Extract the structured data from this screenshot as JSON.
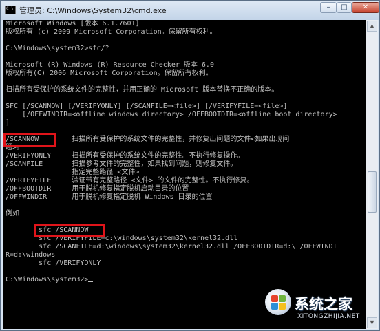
{
  "window": {
    "title": "管理员: C:\\Windows\\System32\\cmd.exe",
    "icon": "cmd-icon",
    "buttons": {
      "minimize": "–",
      "maximize": "□",
      "close": "✕"
    }
  },
  "console": {
    "lines": [
      "Microsoft Windows [版本 6.1.7601]",
      "版权所有 (c) 2009 Microsoft Corporation。保留所有权利。",
      "",
      "C:\\Windows\\system32>sfc/?",
      "",
      "Microsoft (R) Windows (R) Resource Checker 版本 6.0",
      "版权所有(C) 2006 Microsoft Corporation。保留所有权利。",
      "",
      "扫描所有受保护的系统文件的完整性，并用正确的 Microsoft 版本替换不正确的版本。",
      "",
      "SFC [/SCANNOW] [/VERIFYONLY] [/SCANFILE=<file>] [/VERIFYFILE=<file>]",
      "    [/OFFWINDIR=<offline windows directory> /OFFBOOTDIR=<offline boot directory>",
      "]",
      "",
      "/SCANNOW        扫描所有受保护的系统文件的完整性，并修复出问题的文件<如果出现问",
      "题>。",
      "/VERIFYONLY     扫描所有受保护的系统文件的完整性。不执行修复操作。",
      "/SCANFILE       扫描参考文件的完整性，如果找到问题，则修复文件。",
      "                指定完整路径 <文件>",
      "/VERIFYFILE     验证带有完整路径 <文件> 的文件的完整性。不执行修复。",
      "/OFFBOOTDIR     用于脱机修复指定脱机启动目录的位置",
      "/OFFWINDIR      用于脱机修复指定脱机 Windows 目录的位置",
      "",
      "例如",
      "",
      "        sfc /SCANNOW",
      "        sfc /VERIFYFILE=c:\\windows\\system32\\kernel32.dll",
      "        sfc /SCANFILE=d:\\windows\\system32\\kernel32.dll /OFFBOOTDIR=d:\\ /OFFWINDI",
      "R=d:\\windows",
      "        sfc /VERIFYONLY",
      "",
      "C:\\Windows\\system32>"
    ]
  },
  "highlights": [
    {
      "label": "scannow-option"
    },
    {
      "label": "scannow-example"
    }
  ],
  "watermark": {
    "text": "系统之家",
    "url": "XITONGZHIJIA.NET"
  },
  "colors": {
    "console_bg": "#000000",
    "console_text": "#c0c0c0",
    "highlight": "#e0141a",
    "titlebar": "#c3d4e8"
  }
}
